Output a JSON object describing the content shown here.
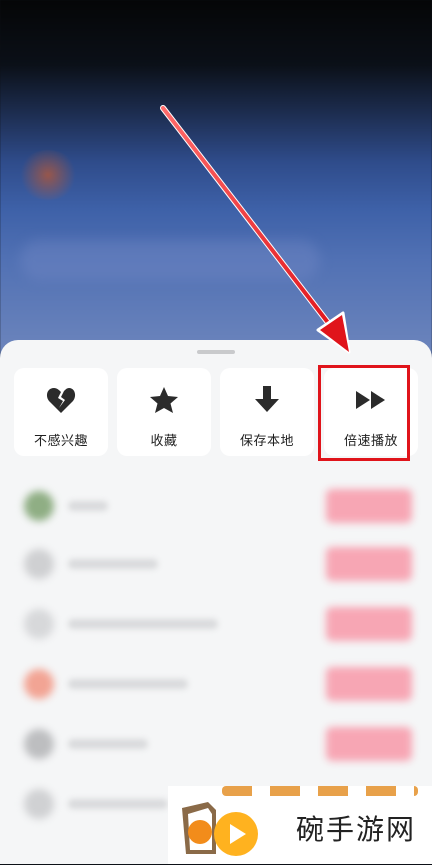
{
  "actions": [
    {
      "id": "not-interested",
      "label": "不感兴趣",
      "icon": "broken-heart-icon"
    },
    {
      "id": "favorite",
      "label": "收藏",
      "icon": "star-icon"
    },
    {
      "id": "save-local",
      "label": "保存本地",
      "icon": "download-arrow-icon"
    },
    {
      "id": "playback-speed",
      "label": "倍速播放",
      "icon": "fast-forward-icon"
    }
  ],
  "watermark": {
    "text": "碗手游网"
  },
  "colors": {
    "accent_red": "#e0141b",
    "sheet_bg": "#f5f6f7",
    "card_bg": "#ffffff",
    "pill_pink": "#f7a6b4"
  }
}
